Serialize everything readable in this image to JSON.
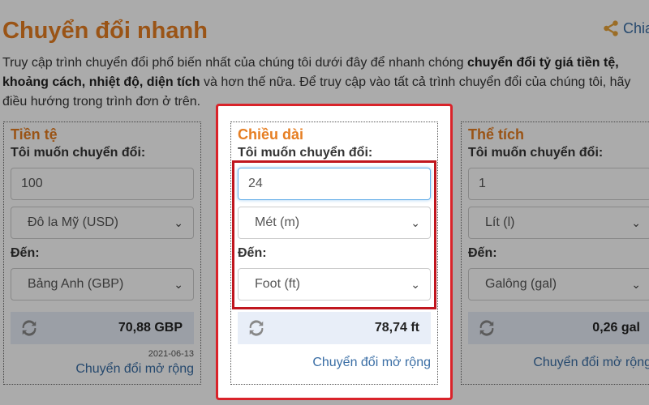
{
  "header": {
    "title": "Chuyển đổi nhanh",
    "share_label": "Chia",
    "share_icon": "share-icon"
  },
  "intro": {
    "line1_a": "Truy cập trình chuyển đổi phổ biến nhất của chúng tôi dưới đây để nhanh chóng ",
    "line1_b": "chuyển đổi tỷ giá tiền tệ,",
    "line2_a": "khoảng cách, nhiệt độ, diện tích",
    "line2_b": " và hơn thế nữa. Để truy cập vào tất cả trình chuyển đổi của chúng tôi, hãy",
    "line3": "điều hướng trong trình đơn ở trên."
  },
  "cards": [
    {
      "title": "Tiền tệ",
      "from_label": "Tôi muốn chuyển đổi:",
      "amount": "100",
      "from_unit": "Đô la Mỹ (USD)",
      "to_label": "Đến:",
      "to_unit": "Bảng Anh (GBP)",
      "result": "70,88 GBP",
      "date": "2021-06-13",
      "more_link": "Chuyển đổi mở rộng"
    },
    {
      "title": "Chiều dài",
      "from_label": "Tôi muốn chuyển đổi:",
      "amount": "24",
      "from_unit": "Mét (m)",
      "to_label": "Đến:",
      "to_unit": "Foot (ft)",
      "result": "78,74 ft",
      "more_link": "Chuyển đổi mở rộng"
    },
    {
      "title": "Thể tích",
      "from_label": "Tôi muốn chuyển đổi:",
      "amount": "1",
      "from_unit": "Lít (l)",
      "to_label": "Đến:",
      "to_unit": "Galông (gal)",
      "result": "0,26 gal",
      "more_link": "Chuyển đổi mở rộng"
    }
  ],
  "colors": {
    "accent": "#e67e22",
    "link": "#3a6ea5",
    "highlight": "#d9232a",
    "result_bg": "#e8eef8"
  }
}
